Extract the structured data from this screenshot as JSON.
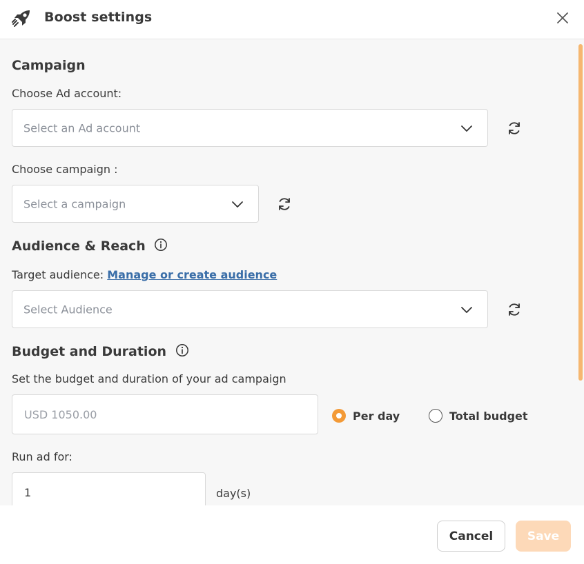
{
  "header": {
    "icon": "rocket-icon",
    "title": "Boost settings",
    "close_icon": "close-icon"
  },
  "campaign": {
    "heading": "Campaign",
    "ad_account_label": "Choose Ad account:",
    "ad_account_placeholder": "Select an Ad account",
    "campaign_label": "Choose campaign :",
    "campaign_placeholder": "Select a campaign"
  },
  "audience": {
    "heading": "Audience & Reach",
    "target_label": "Target audience:",
    "manage_link": "Manage or create audience",
    "placeholder": "Select Audience"
  },
  "budget": {
    "heading": "Budget and Duration",
    "description": "Set the budget and duration of your ad campaign",
    "amount_placeholder": "USD 1050.00",
    "options": [
      {
        "label": "Per day",
        "selected": true
      },
      {
        "label": "Total budget",
        "selected": false
      }
    ],
    "run_label": "Run ad for:",
    "days_value": "1",
    "days_suffix": "day(s)"
  },
  "footer": {
    "cancel_label": "Cancel",
    "save_label": "Save"
  },
  "colors": {
    "accent": "#f39a37",
    "save_disabled": "#fdd9b8",
    "link": "#3a6ea8",
    "scrollbar": "#f6b770"
  }
}
